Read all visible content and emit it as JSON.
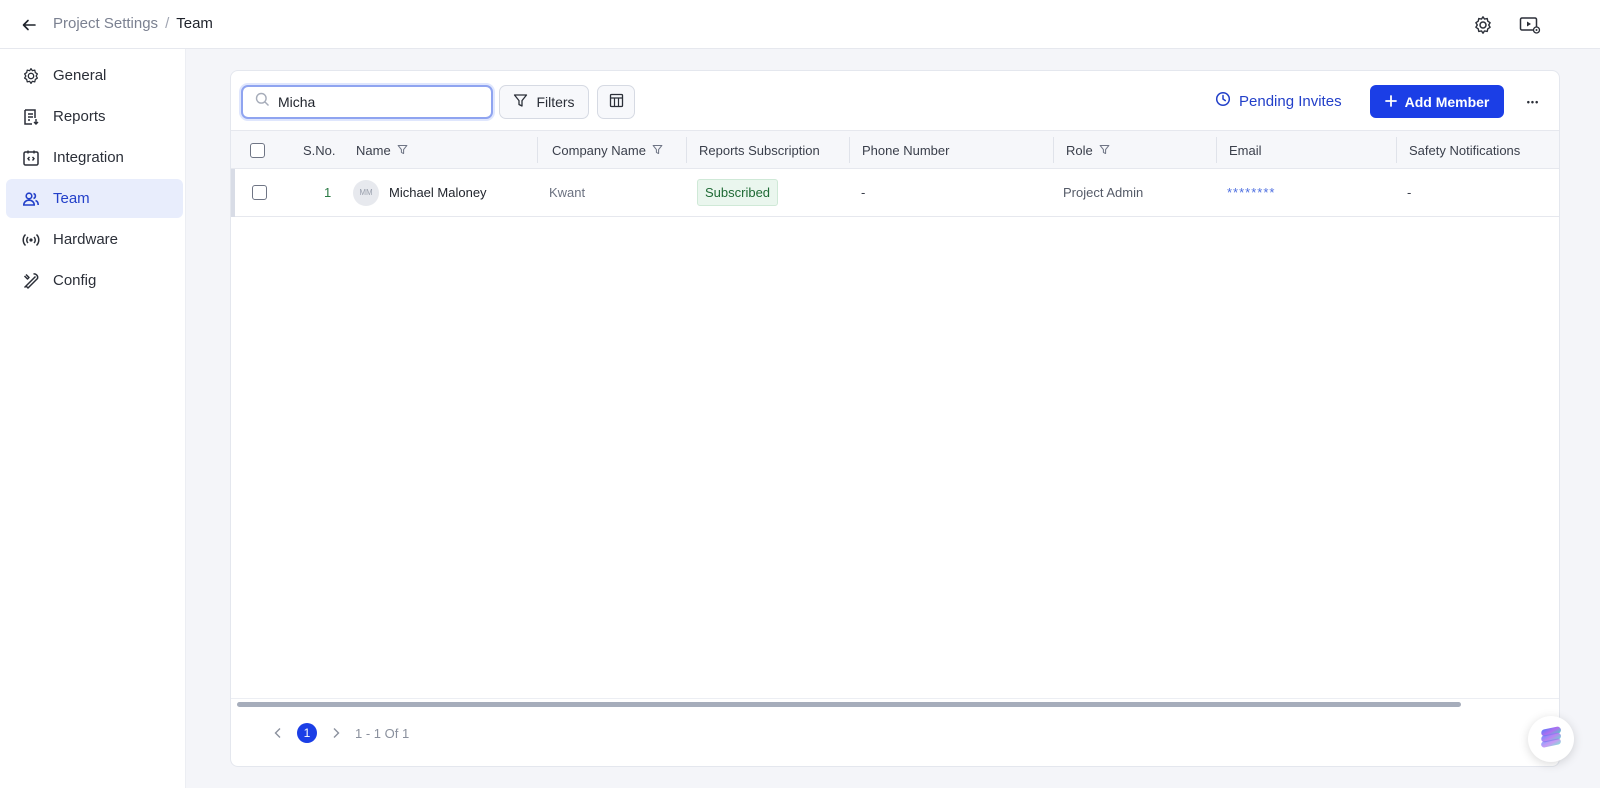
{
  "header": {
    "breadcrumb_parent": "Project Settings",
    "breadcrumb_separator": "/",
    "breadcrumb_current": "Team"
  },
  "sidebar": {
    "items": [
      {
        "label": "General",
        "icon": "gear-icon"
      },
      {
        "label": "Reports",
        "icon": "report-icon"
      },
      {
        "label": "Integration",
        "icon": "integration-icon"
      },
      {
        "label": "Team",
        "icon": "team-icon",
        "active": true
      },
      {
        "label": "Hardware",
        "icon": "broadcast-icon"
      },
      {
        "label": "Config",
        "icon": "tools-icon"
      }
    ]
  },
  "toolbar": {
    "search_value": "Micha",
    "filters_label": "Filters",
    "pending_invites_label": "Pending Invites",
    "add_member_label": "Add Member",
    "more_label": "•••"
  },
  "table": {
    "columns": [
      "S.No.",
      "Name",
      "Company Name",
      "Reports Subscription",
      "Phone Number",
      "Role",
      "Email",
      "Safety Notifications"
    ],
    "rows": [
      {
        "sno": "1",
        "initials": "MM",
        "name": "Michael Maloney",
        "company": "Kwant",
        "subscription": "Subscribed",
        "phone": "-",
        "role": "Project Admin",
        "email": "********",
        "safety": "-"
      }
    ]
  },
  "pagination": {
    "current_page": "1",
    "summary": "1 - 1 Of 1"
  },
  "colors": {
    "primary": "#1b3ee6",
    "active_nav_bg": "#e8edfc",
    "badge_bg": "#eaf6ee",
    "badge_text": "#1f6a35"
  }
}
